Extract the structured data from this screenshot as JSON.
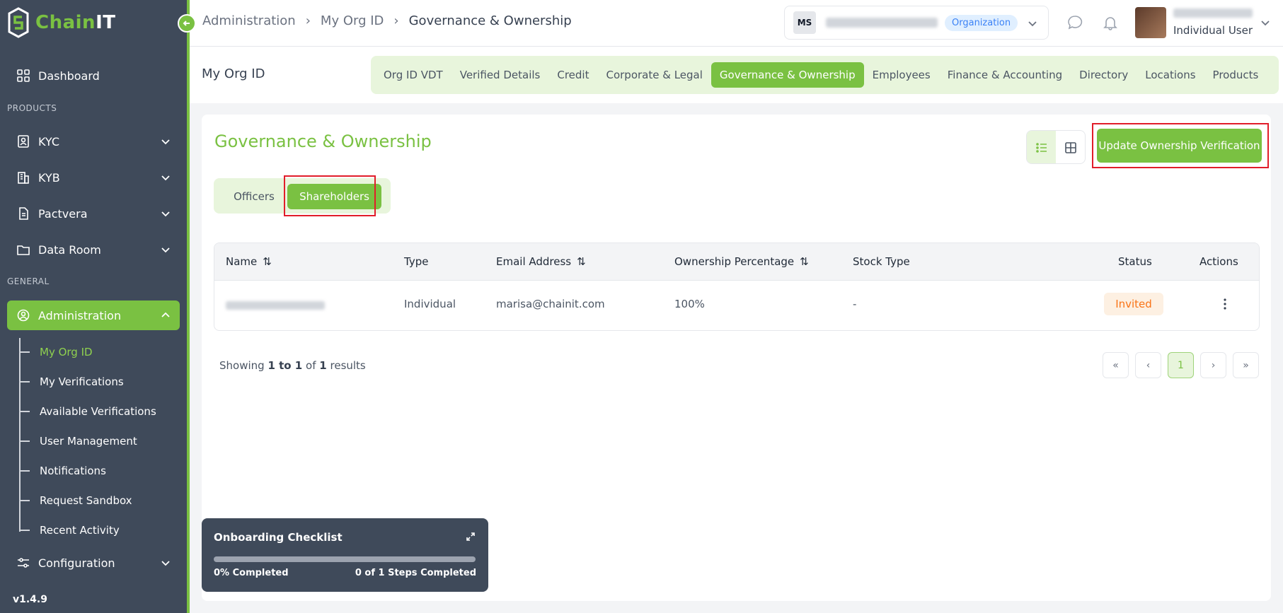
{
  "brand": {
    "name_main": "Chain",
    "name_accent": "IT",
    "accent_color": "#7ac142"
  },
  "sidebar": {
    "dashboard": "Dashboard",
    "products_label": "PRODUCTS",
    "kyc": "KYC",
    "kyb": "KYB",
    "pactvera": "Pactvera",
    "data_room": "Data Room",
    "general_label": "GENERAL",
    "administration": "Administration",
    "sub_items": [
      "My Org ID",
      "My Verifications",
      "Available Verifications",
      "User Management",
      "Notifications",
      "Request Sandbox",
      "Recent Activity"
    ],
    "configuration": "Configuration",
    "version": "v1.4.9"
  },
  "header": {
    "breadcrumb": [
      "Administration",
      "My Org ID",
      "Governance & Ownership"
    ],
    "org_avatar": "MS",
    "org_badge": "Organization",
    "user_role": "Individual User"
  },
  "subheader": {
    "page_label": "My Org ID",
    "tabs": [
      "Org ID VDT",
      "Verified Details",
      "Credit",
      "Corporate & Legal",
      "Governance & Ownership",
      "Employees",
      "Finance & Accounting",
      "Directory",
      "Locations",
      "Products"
    ],
    "active_tab": "Governance & Ownership"
  },
  "main": {
    "title": "Governance & Ownership",
    "update_button": "Update Ownership Verification",
    "segments": [
      "Officers",
      "Shareholders"
    ],
    "active_segment": "Shareholders",
    "table": {
      "headers": [
        "Name",
        "Type",
        "Email Address",
        "Ownership Percentage",
        "Stock Type",
        "Status",
        "Actions"
      ],
      "rows": [
        {
          "type": "Individual",
          "email": "marisa@chainit.com",
          "ownership": "100%",
          "stock_type": "-",
          "status": "Invited"
        }
      ]
    },
    "results": {
      "prefix": "Showing",
      "range": "1 to 1",
      "of": "of",
      "total": "1",
      "suffix": "results"
    },
    "pager": {
      "first": "«",
      "prev": "‹",
      "current": "1",
      "next": "›",
      "last": "»"
    }
  },
  "onboarding": {
    "title": "Onboarding Checklist",
    "progress_percent": 0,
    "completed_text": "0% Completed",
    "steps_text": "0 of 1 Steps Completed"
  }
}
